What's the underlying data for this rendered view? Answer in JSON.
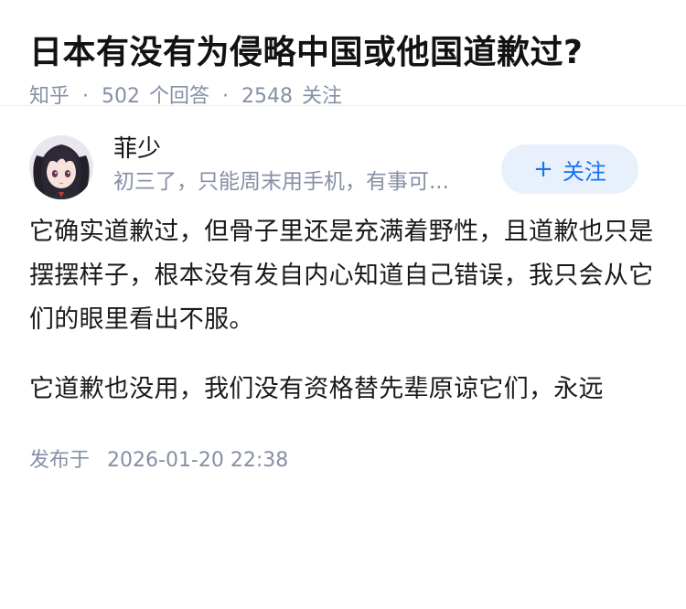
{
  "question": {
    "title": "日本有没有为侵略中国或他国道歉过?",
    "source": "知乎",
    "answers_count": "502",
    "answers_label": "个回答",
    "followers_count": "2548",
    "followers_label": "关注"
  },
  "answer": {
    "author": {
      "name": "菲少",
      "bio": "初三了，只能周末用手机，有事可..."
    },
    "follow_button": {
      "icon": "plus-icon",
      "label": "关注"
    },
    "paragraphs": [
      "它确实道歉过，但骨子里还是充满着野性，且道歉也只是摆摆样子，根本没有发自内心知道自己错误，我只会从它们的眼里看出不服。",
      "它道歉也没用，我们没有资格替先辈原谅它们，永远"
    ],
    "publish_label": "发布于",
    "publish_time": "2026-01-20 22:38"
  },
  "colors": {
    "accent": "#1772f6",
    "follow_bg": "#e8f0fc",
    "meta": "#8590a6",
    "text": "#1a1a1a"
  }
}
